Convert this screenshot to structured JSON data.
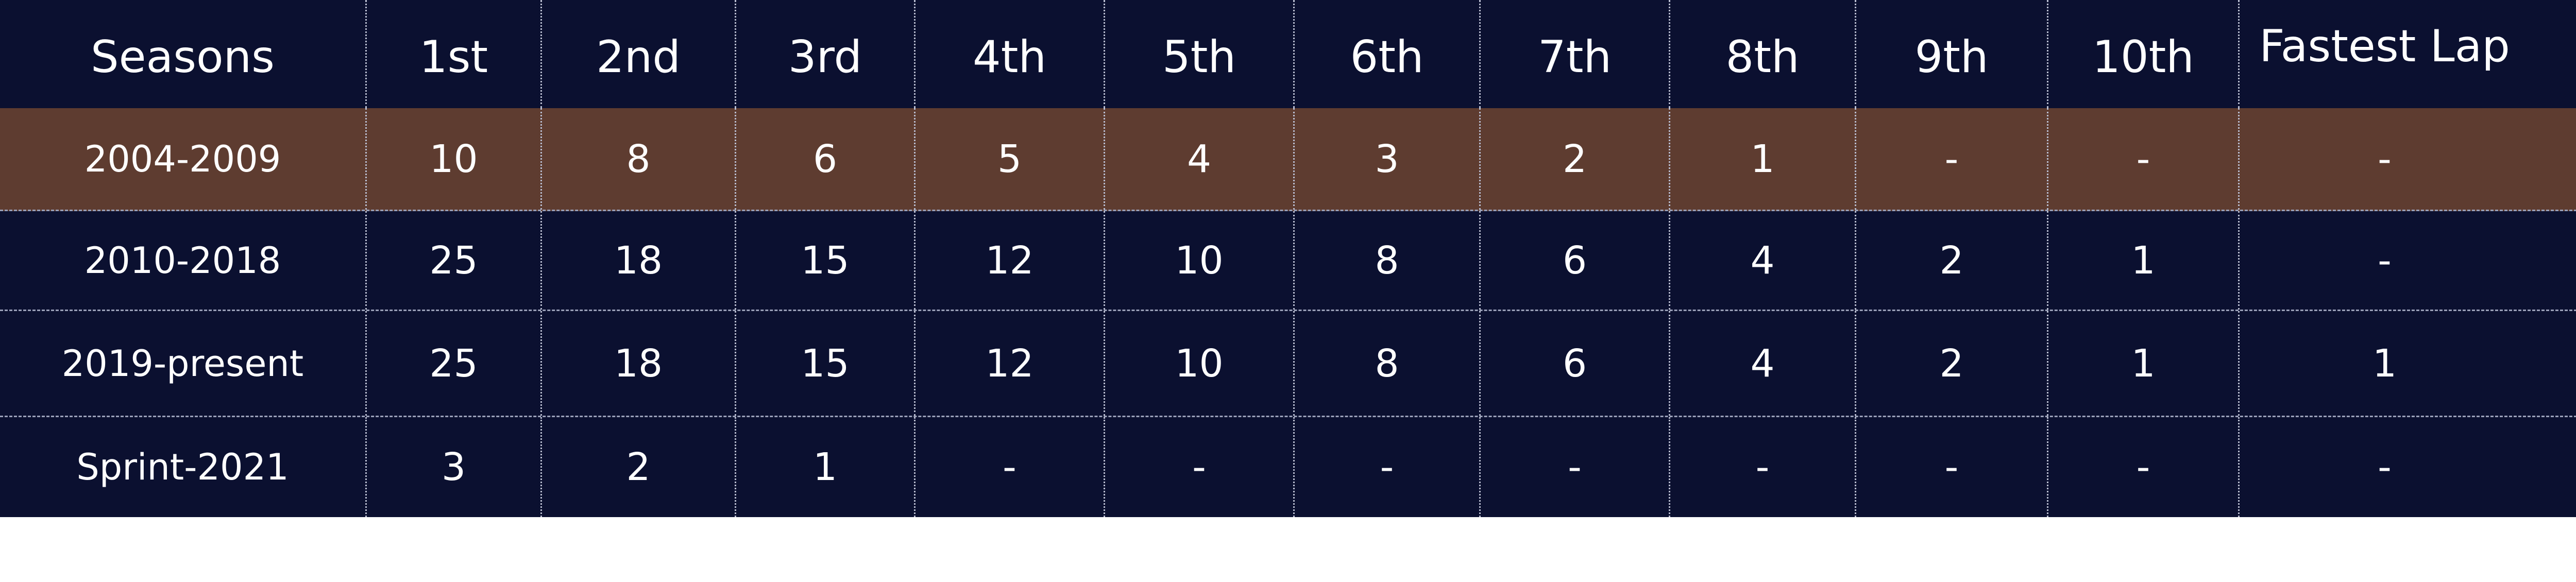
{
  "table": {
    "headers": [
      "Seasons",
      "1st",
      "2nd",
      "3rd",
      "4th",
      "5th",
      "6th",
      "7th",
      "8th",
      "9th",
      "10th",
      "Fastest Lap"
    ],
    "rows": [
      [
        "2004-2009",
        "10",
        "8",
        "6",
        "5",
        "4",
        "3",
        "2",
        "1",
        "-",
        "-",
        "-"
      ],
      [
        "2010-2018",
        "25",
        "18",
        "15",
        "12",
        "10",
        "8",
        "6",
        "4",
        "2",
        "1",
        "-"
      ],
      [
        "2019-present",
        "25",
        "18",
        "15",
        "12",
        "10",
        "8",
        "6",
        "4",
        "2",
        "1",
        "1"
      ],
      [
        "Sprint-2021",
        "3",
        "2",
        "1",
        "-",
        "-",
        "-",
        "-",
        "-",
        "-",
        "-",
        "-"
      ]
    ]
  },
  "colors": {
    "background": "#0b1030",
    "highlight_row": "#5e3c30",
    "text": "#ffffff"
  }
}
